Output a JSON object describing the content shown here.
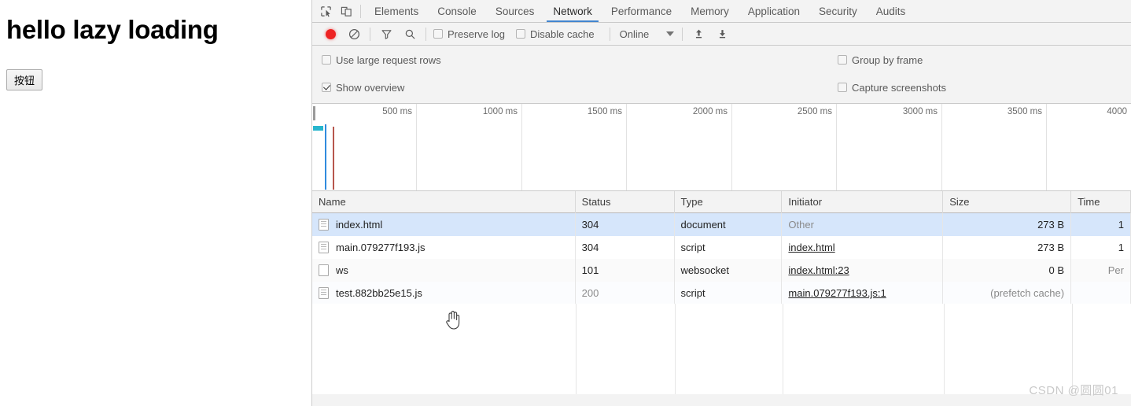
{
  "page": {
    "heading": "hello lazy loading",
    "button_label": "按钮"
  },
  "devtools": {
    "inspect_icon": "inspect-element-icon",
    "device_icon": "toggle-device-toolbar-icon",
    "tabs": [
      {
        "label": "Elements",
        "active": false
      },
      {
        "label": "Console",
        "active": false
      },
      {
        "label": "Sources",
        "active": false
      },
      {
        "label": "Network",
        "active": true
      },
      {
        "label": "Performance",
        "active": false
      },
      {
        "label": "Memory",
        "active": false
      },
      {
        "label": "Application",
        "active": false
      },
      {
        "label": "Security",
        "active": false
      },
      {
        "label": "Audits",
        "active": false
      }
    ],
    "toolbar": {
      "record_icon": "record-button-icon",
      "clear_icon": "clear-icon",
      "filter_icon": "filter-funnel-icon",
      "search_icon": "search-icon",
      "preserve_log_label": "Preserve log",
      "preserve_log_checked": false,
      "disable_cache_label": "Disable cache",
      "disable_cache_checked": false,
      "throttle_value": "Online",
      "import_icon": "import-har-icon",
      "export_icon": "export-har-icon"
    },
    "settings": {
      "large_rows_label": "Use large request rows",
      "large_rows_checked": false,
      "show_overview_label": "Show overview",
      "show_overview_checked": true,
      "group_by_frame_label": "Group by frame",
      "group_by_frame_checked": false,
      "capture_screenshots_label": "Capture screenshots",
      "capture_screenshots_checked": false
    },
    "overview": {
      "ticks": [
        "500 ms",
        "1000 ms",
        "1500 ms",
        "2000 ms",
        "2500 ms",
        "3000 ms",
        "3500 ms",
        "4000"
      ],
      "dom_content_loaded_color": "#318bde",
      "load_event_color": "#b7564d",
      "request_bar_color": "#28b5cd"
    },
    "table": {
      "columns": [
        "Name",
        "Status",
        "Type",
        "Initiator",
        "Size",
        "Time"
      ],
      "rows": [
        {
          "name": "index.html",
          "status": "304",
          "type": "document",
          "initiator": "Other",
          "initiator_link": false,
          "size": "273 B",
          "time": "1",
          "selected": true,
          "status_muted": false,
          "size_muted": false,
          "time_muted": false,
          "icon": "document-file-icon"
        },
        {
          "name": "main.079277f193.js",
          "status": "304",
          "type": "script",
          "initiator": "index.html",
          "initiator_link": true,
          "size": "273 B",
          "time": "1",
          "selected": false,
          "status_muted": false,
          "size_muted": false,
          "time_muted": false,
          "icon": "script-file-icon"
        },
        {
          "name": "ws",
          "status": "101",
          "type": "websocket",
          "initiator": "index.html:23",
          "initiator_link": true,
          "size": "0 B",
          "time": "Per",
          "selected": false,
          "status_muted": false,
          "size_muted": false,
          "time_muted": true,
          "icon": "websocket-file-icon"
        },
        {
          "name": "test.882bb25e15.js",
          "status": "200",
          "type": "script",
          "initiator": "main.079277f193.js:1",
          "initiator_link": true,
          "size": "(prefetch cache)",
          "time": "",
          "selected": false,
          "status_muted": true,
          "size_muted": true,
          "time_muted": true,
          "icon": "script-file-icon"
        }
      ]
    },
    "watermark": "CSDN @圆圆01"
  }
}
